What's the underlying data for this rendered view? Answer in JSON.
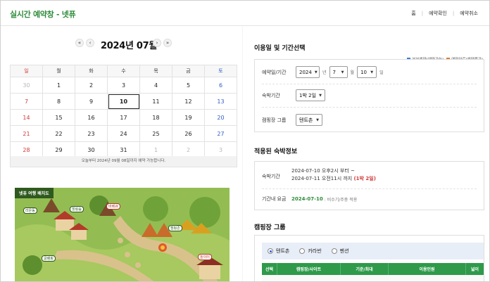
{
  "header": {
    "title": "실시간 예약창 - 넷퓨",
    "nav": [
      "홈",
      "예약확인",
      "예약취소"
    ]
  },
  "calendar": {
    "month_label": "2024년 07월",
    "nav": {
      "first": "«",
      "prev": "‹",
      "next": "›",
      "last": "»"
    },
    "legend": [
      {
        "label": "부분예약(예약가능)",
        "color": "#3b7ad9"
      },
      {
        "label": "예약완료(예약불가)",
        "color": "#e07b2a"
      }
    ],
    "weekdays": [
      "일",
      "월",
      "화",
      "수",
      "목",
      "금",
      "토"
    ],
    "weeks": [
      [
        "30",
        "1",
        "2",
        "3",
        "4",
        "5",
        "6"
      ],
      [
        "7",
        "8",
        "9",
        "10",
        "11",
        "12",
        "13"
      ],
      [
        "14",
        "15",
        "16",
        "17",
        "18",
        "19",
        "20"
      ],
      [
        "21",
        "22",
        "23",
        "24",
        "25",
        "26",
        "27"
      ],
      [
        "28",
        "29",
        "30",
        "31",
        "1",
        "2",
        "3"
      ]
    ],
    "note": "오늘부터 2024년 09월 08일까지 예약 가능합니다."
  },
  "map": {
    "title": "넷퓨 여행 배치도",
    "labels": [
      "라온동",
      "힐링숲",
      "캠핑존",
      "바베큐",
      "글램핑",
      "놀이터"
    ]
  },
  "selection": {
    "section_title": "이용일 및 기간선택",
    "date_label": "예약일/기간",
    "year": "2024",
    "year_unit": "년",
    "month": "7",
    "month_unit": "월",
    "day": "10",
    "day_unit": "일",
    "nights_label": "숙박기간",
    "nights_value": "1박 2일",
    "group_label": "캠핑장 그룹",
    "group_value": "텐트촌"
  },
  "stay_info": {
    "section_title": "적용된 숙박정보",
    "period_label": "숙박기간",
    "line1": "2024-07-10 오후2시 부터 ~",
    "line2_main": "2024-07-11 오전11시 까지",
    "line2_nights": "(1박 2일)",
    "rate_label": "기간내 요금",
    "rate_date": "2024-07-10",
    "rate_desc": ": 비수기/주중 적용"
  },
  "camp_group": {
    "section_title": "캠핑장 그룹",
    "options": [
      "텐트촌",
      "카라반",
      "펜션"
    ],
    "selected": "텐트촌",
    "columns": [
      "선택",
      "캠핑장/사이트",
      "기준/최대",
      "이용인원",
      "넓이"
    ]
  },
  "colors": {
    "brand_green": "#2e8b3a",
    "table_header_green": "#2e9a4a",
    "sunday_red": "#d23b3b",
    "saturday_blue": "#2f5fc4"
  }
}
